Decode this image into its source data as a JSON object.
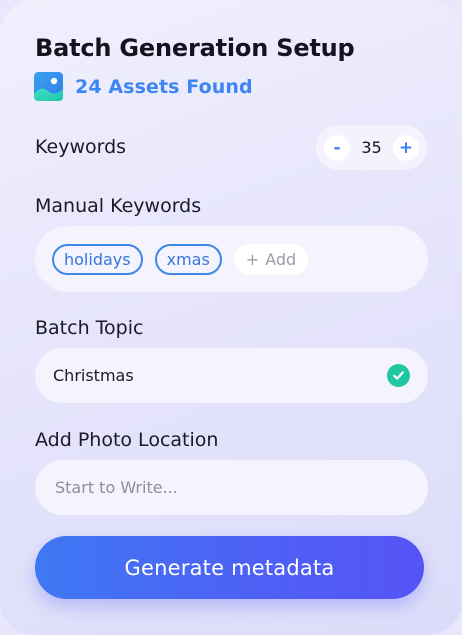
{
  "header": {
    "title": "Batch Generation Setup",
    "assets_found": "24 Assets Found",
    "assets_icon": "image-icon"
  },
  "keywords": {
    "label": "Keywords",
    "decrement_label": "-",
    "increment_label": "+",
    "value": "35"
  },
  "manual_keywords": {
    "label": "Manual Keywords",
    "tags": [
      "holidays",
      "xmas"
    ],
    "add_label": "Add",
    "add_symbol": "+"
  },
  "batch_topic": {
    "label": "Batch Topic",
    "value": "Christmas",
    "status_icon": "check-circle-icon"
  },
  "photo_location": {
    "label": "Add Photo Location",
    "placeholder": "Start to Write...",
    "value": ""
  },
  "actions": {
    "generate_label": "Generate metadata"
  },
  "colors": {
    "accent_blue": "#3d85f2",
    "check_green": "#1fc7a3",
    "button_start": "#3f78f3",
    "button_end": "#5554f6"
  }
}
